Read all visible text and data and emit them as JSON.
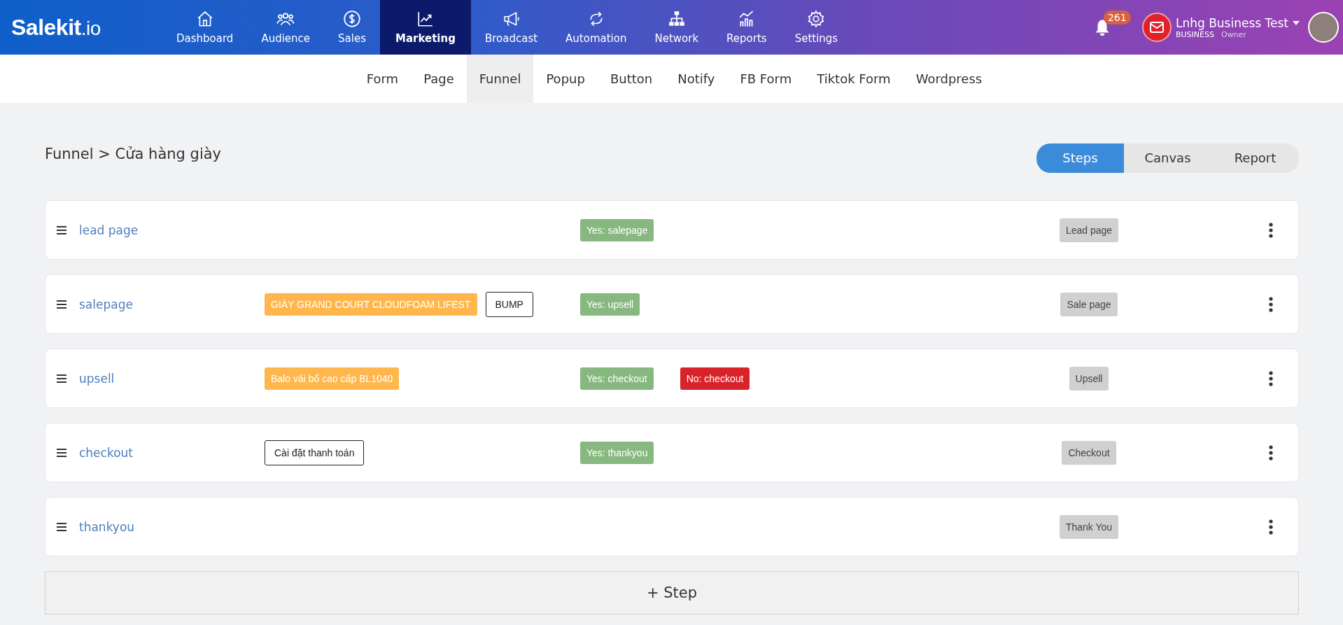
{
  "header": {
    "logo": "Salekit",
    "logo_suffix": ".io",
    "nav": [
      {
        "label": "Dashboard",
        "selected": false
      },
      {
        "label": "Audience",
        "selected": false
      },
      {
        "label": "Sales",
        "selected": false
      },
      {
        "label": "Marketing",
        "selected": true
      },
      {
        "label": "Broadcast",
        "selected": false
      },
      {
        "label": "Automation",
        "selected": false
      },
      {
        "label": "Network",
        "selected": false
      },
      {
        "label": "Reports",
        "selected": false
      },
      {
        "label": "Settings",
        "selected": false
      }
    ],
    "notifications": "261",
    "user": {
      "name": "Lnhg Business Test",
      "plan": "BUSINESS",
      "role": "Owner"
    }
  },
  "subnav": [
    {
      "label": "Form",
      "selected": false
    },
    {
      "label": "Page",
      "selected": false
    },
    {
      "label": "Funnel",
      "selected": true
    },
    {
      "label": "Popup",
      "selected": false
    },
    {
      "label": "Button",
      "selected": false
    },
    {
      "label": "Notify",
      "selected": false
    },
    {
      "label": "FB Form",
      "selected": false
    },
    {
      "label": "Tiktok Form",
      "selected": false
    },
    {
      "label": "Wordpress",
      "selected": false
    }
  ],
  "breadcrumb": "Funnel > Cửa hàng giày",
  "views": [
    {
      "label": "Steps",
      "selected": true
    },
    {
      "label": "Canvas",
      "selected": false
    },
    {
      "label": "Report",
      "selected": false
    }
  ],
  "steps": [
    {
      "name": "lead page",
      "flows": [
        {
          "kind": "yes",
          "label": "Yes: salepage"
        }
      ],
      "type": "Lead page"
    },
    {
      "name": "salepage",
      "items": [
        {
          "kind": "product",
          "label": "GIÀY GRAND COURT CLOUDFOAM LIFEST"
        },
        {
          "kind": "outline",
          "label": "BUMP"
        }
      ],
      "flows": [
        {
          "kind": "yes",
          "label": "Yes: upsell"
        }
      ],
      "type": "Sale page"
    },
    {
      "name": "upsell",
      "items": [
        {
          "kind": "product",
          "label": "Balo vải bố cao cấp BL1040"
        }
      ],
      "flows": [
        {
          "kind": "yes",
          "label": "Yes: checkout"
        },
        {
          "kind": "no",
          "label": "No: checkout"
        }
      ],
      "type": "Upsell"
    },
    {
      "name": "checkout",
      "items": [
        {
          "kind": "outline",
          "label": "Cài đặt thanh toán"
        }
      ],
      "flows": [
        {
          "kind": "yes",
          "label": "Yes: thankyou"
        }
      ],
      "type": "Checkout"
    },
    {
      "name": "thankyou",
      "type": "Thank You"
    }
  ],
  "add_step": "+ Step"
}
